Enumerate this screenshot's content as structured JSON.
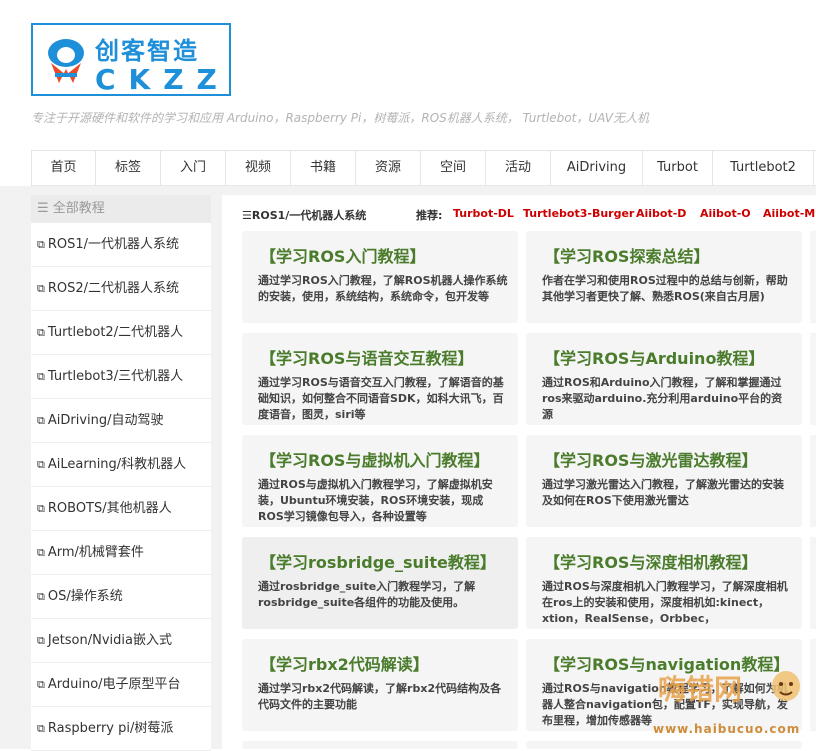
{
  "logo": {
    "cn_text": "创客智造",
    "en_text": "CKZZ"
  },
  "tagline": "专注于开源硬件和软件的学习和应用 Arduino，Raspberry Pi，树莓派，ROS机器人系统， Turtlebot，UAV无人机",
  "nav": [
    "首页",
    "标签",
    "入门",
    "视频",
    "书籍",
    "资源",
    "空间",
    "活动",
    "AiDriving",
    "Turbot",
    "Turtlebot2"
  ],
  "sidebar": {
    "header": "全部教程",
    "items": [
      "ROS1/一代机器人系统",
      "ROS2/二代机器人系统",
      "Turtlebot2/二代机器人",
      "Turtlebot3/三代机器人",
      "AiDriving/自动驾驶",
      "AiLearning/科教机器人",
      "ROBOTS/其他机器人",
      "Arm/机械臂套件",
      "OS/操作系统",
      "Jetson/Nvidia嵌入式",
      "Arduino/电子原型平台",
      "Raspberry pi/树莓派"
    ]
  },
  "main": {
    "category": "ROS1/一代机器人系统",
    "recommend_label": "推荐:",
    "recommend_links": [
      "Turbot-DL",
      "Turtlebot3-Burger",
      "Aiibot-D",
      "Aiibot-O",
      "Aiibot-M"
    ],
    "cards": [
      {
        "title": "【学习ROS入门教程】",
        "desc": "通过学习ROS入门教程，了解ROS机器人操作系统的安装，使用，系统结构，系统命令，包开发等"
      },
      {
        "title": "【学习ROS探索总结】",
        "desc": "作者在学习和使用ROS过程中的总结与创新，帮助其他学习者更快了解、熟悉ROS(来自古月居)"
      },
      {
        "title": "【学习ROS与语音交互教程】",
        "desc": "通过学习ROS与语音交互入门教程，了解语音的基础知识，如何整合不同语音SDK，如科大讯飞，百度语音，图灵，siri等"
      },
      {
        "title": "【学习ROS与Arduino教程】",
        "desc": "通过ROS和Arduino入门教程，了解和掌握通过ros来驱动arduino.充分利用arduino平台的资源"
      },
      {
        "title": "【学习ROS与虚拟机入门教程】",
        "desc": "通过ROS与虚拟机入门教程学习，了解虚拟机安装，Ubuntu环境安装，ROS环境安装，现成ROS学习镜像包导入，各种设置等"
      },
      {
        "title": "【学习ROS与激光雷达教程】",
        "desc": "通过学习激光雷达入门教程，了解激光雷达的安装及如何在ROS下使用激光雷达"
      },
      {
        "title": "【学习rosbridge_suite教程】",
        "desc": "通过rosbridge_suite入门教程学习，了解rosbridge_suite各组件的功能及使用。"
      },
      {
        "title": "【学习ROS与深度相机教程】",
        "desc": "通过ROS与深度相机入门教程学习，了解深度相机在ros上的安装和使用，深度相机如:kinect，xtion，RealSense，Orbbec，"
      },
      {
        "title": "【学习rbx2代码解读】",
        "desc": "通过学习rbx2代码解读，了解rbx2代码结构及各代码文件的主要功能"
      },
      {
        "title": "【学习ROS与navigation教程】",
        "desc": "通过ROS与navigation教程学习，了解如何为机器人整合navigation包，配置TF，实现导航，发布里程，增加传感器等"
      }
    ]
  },
  "watermark": {
    "text": "嗨错网",
    "url": "www.haibucuo.com"
  },
  "colors": {
    "brand": "#1e8fd9",
    "card_title": "#4a7c2c",
    "recommend": "#cc0000"
  }
}
